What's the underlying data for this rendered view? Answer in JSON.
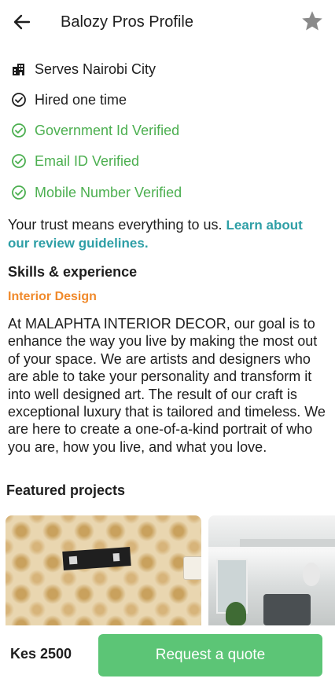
{
  "header": {
    "title": "Balozy Pros Profile",
    "back_icon": "arrow-left-icon",
    "favorite_icon": "star-icon"
  },
  "info": [
    {
      "icon": "building-icon",
      "text": "Serves Nairobi City",
      "verified": false
    },
    {
      "icon": "check-circle-icon",
      "text": "Hired one time",
      "verified": false
    },
    {
      "icon": "check-circle-icon",
      "text": "Government Id Verified",
      "verified": true
    },
    {
      "icon": "check-circle-icon",
      "text": "Email ID Verified",
      "verified": true
    },
    {
      "icon": "check-circle-icon",
      "text": "Mobile Number Verified",
      "verified": true
    }
  ],
  "trust": {
    "text": "Your trust means everything to us.",
    "link": "Learn about our review guidelines."
  },
  "skills": {
    "title": "Skills & experience",
    "skill": "Interior Design",
    "about": "At MALAPHTA INTERIOR DECOR, our goal is to enhance the way you live by making the most out of your space. We are artists and designers who are able to take your personality and transform it into well designed art. The result of our craft is exceptional luxury that is tailored and timeless. We are here to create a one-of-a-kind portrait of who you are, how you live, and what you love."
  },
  "projects": {
    "title": "Featured projects"
  },
  "footer": {
    "price": "Kes 2500",
    "cta": "Request a quote"
  },
  "colors": {
    "green": "#4caf50",
    "link": "#2e9fa6",
    "skill": "#f08a2c",
    "button": "#5cc576",
    "star": "#8a8a8a"
  }
}
